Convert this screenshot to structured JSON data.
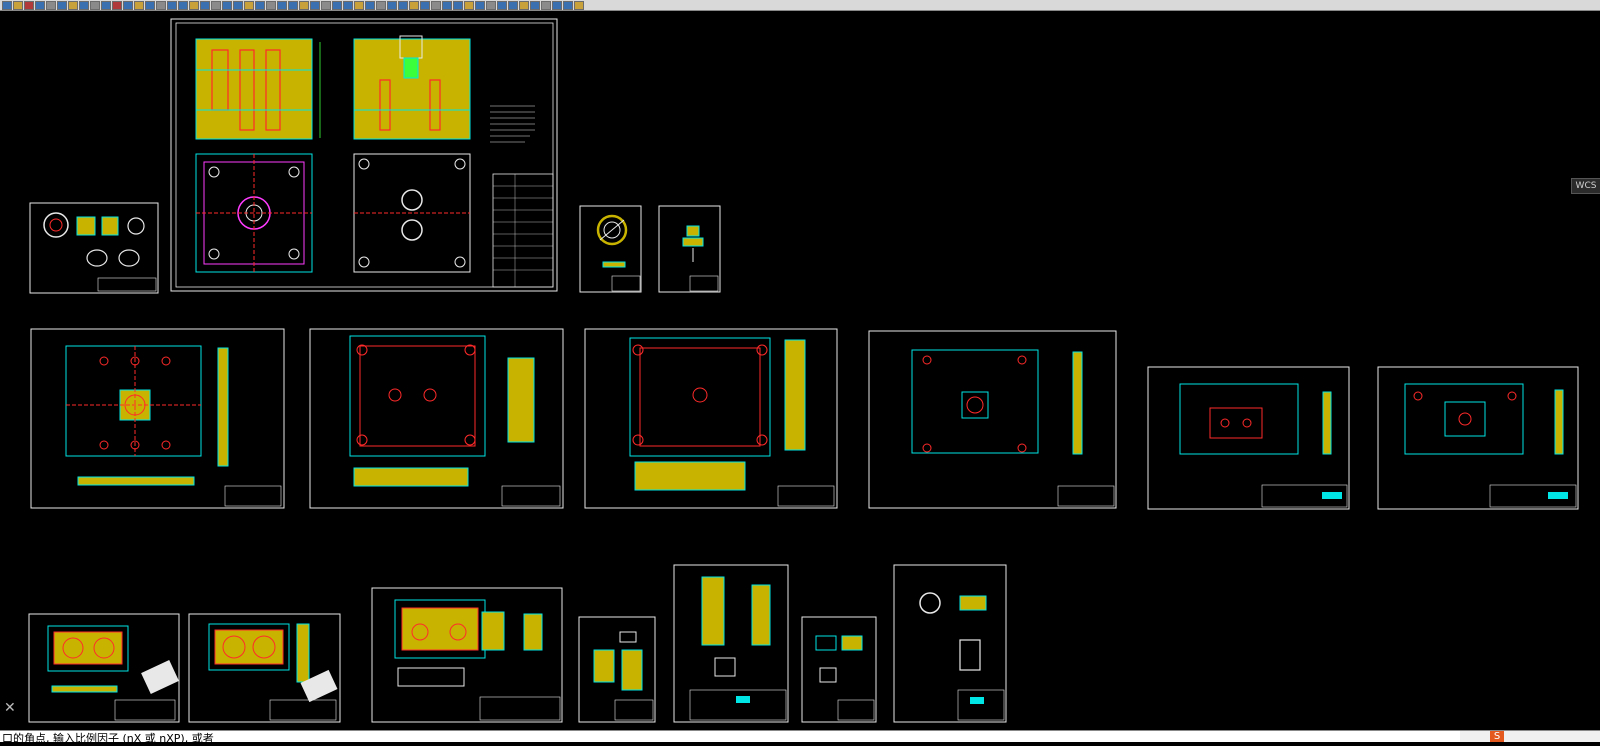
{
  "command_line": {
    "prompt": "口的角点, 输入比例因子 (nX 或 nXP), 或者"
  },
  "viewcube": {
    "wcs_label": "WCS"
  },
  "close_glyph": "✕",
  "ime_badge": "S",
  "colors": {
    "background": "#000000",
    "sheet_border": "#e8e8e8",
    "fill_yellow": "#c8b400",
    "line_cyan": "#00e5e5",
    "line_red": "#ff2a2a",
    "line_green": "#3cff3c",
    "line_magenta": "#ff3cff"
  },
  "drawing_sheets": [
    {
      "id": "assembly-main",
      "kind": "assembly"
    },
    {
      "id": "part-ring",
      "kind": "part"
    },
    {
      "id": "part-small-a",
      "kind": "part"
    },
    {
      "id": "part-small-b",
      "kind": "part"
    },
    {
      "id": "plate-1",
      "kind": "plate"
    },
    {
      "id": "plate-2",
      "kind": "plate"
    },
    {
      "id": "plate-3",
      "kind": "plate"
    },
    {
      "id": "plate-4",
      "kind": "plate"
    },
    {
      "id": "plate-5",
      "kind": "plate"
    },
    {
      "id": "plate-6",
      "kind": "plate"
    },
    {
      "id": "detail-1",
      "kind": "detail"
    },
    {
      "id": "detail-2",
      "kind": "detail"
    },
    {
      "id": "detail-3",
      "kind": "detail"
    },
    {
      "id": "detail-4",
      "kind": "detail"
    },
    {
      "id": "detail-5",
      "kind": "detail"
    },
    {
      "id": "detail-6",
      "kind": "detail"
    },
    {
      "id": "detail-7",
      "kind": "detail"
    }
  ]
}
